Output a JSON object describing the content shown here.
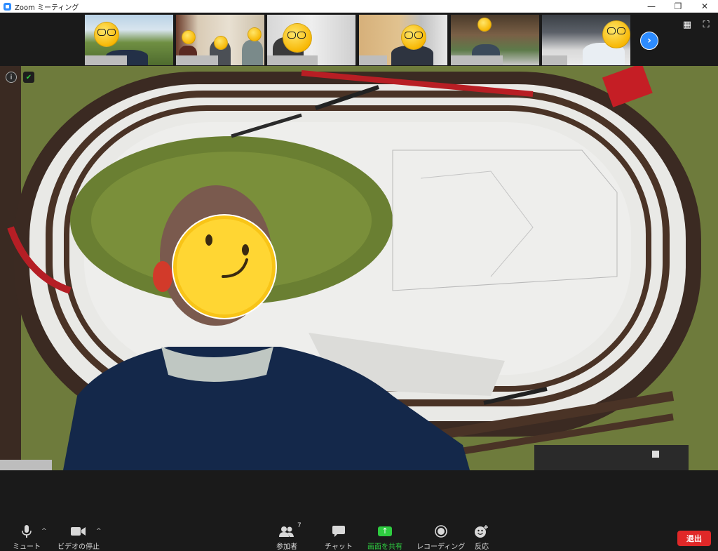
{
  "window": {
    "title": "Zoom ミーティング",
    "minimize": "—",
    "restore": "❐",
    "close": "✕"
  },
  "strip": {
    "next_glyph": "›",
    "gallery_glyph": "▦",
    "fullscreen_glyph": "⛶"
  },
  "main_video": {
    "info_glyph": "i",
    "shield_glyph": "✔"
  },
  "toolbar": {
    "mute_label": "ミュート",
    "video_label": "ビデオの停止",
    "participants_label": "参加者",
    "participants_count": "7",
    "chat_label": "チャット",
    "share_label": "画面を共有",
    "record_label": "レコーディング",
    "reactions_label": "反応",
    "leave_label": "退出",
    "caret": "^"
  },
  "colors": {
    "accent_blue": "#2d8cff",
    "share_green": "#2ecc40",
    "leave_red": "#e02828",
    "background": "#1a1a1a"
  }
}
